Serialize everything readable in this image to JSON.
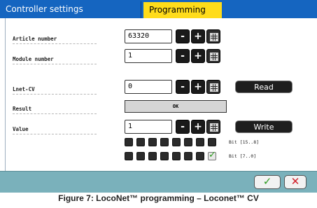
{
  "tabs": [
    {
      "label": "Controller settings",
      "active": false
    },
    {
      "label": "Programming",
      "active": true
    }
  ],
  "fields": {
    "article_number": {
      "label": "Article number",
      "value": "63320"
    },
    "module_number": {
      "label": "Module number",
      "value": "1"
    },
    "lnet_cv": {
      "label": "Lnet-CV",
      "value": "0"
    },
    "result": {
      "label": "Result",
      "value": "OK"
    },
    "value": {
      "label": "Value",
      "value": "1"
    }
  },
  "buttons": {
    "minus": "-",
    "plus": "+",
    "read": "Read",
    "write": "Write",
    "ok": "✓",
    "cancel": "✕"
  },
  "bits": {
    "high_label": "Bit [15..8]",
    "low_label": "Bit [7..0]",
    "high": [
      0,
      0,
      0,
      0,
      0,
      0,
      0,
      0
    ],
    "low": [
      0,
      0,
      0,
      0,
      0,
      0,
      0,
      1
    ]
  },
  "colors": {
    "tab_bar": "#1565c0",
    "active_tab": "#ffdc1a",
    "footer": "#7ab1bb",
    "ok_check": "#2e9a20",
    "cancel_x": "#d0202a"
  },
  "caption": "Figure 7: LocoNet™ programming – Loconet™ CV"
}
